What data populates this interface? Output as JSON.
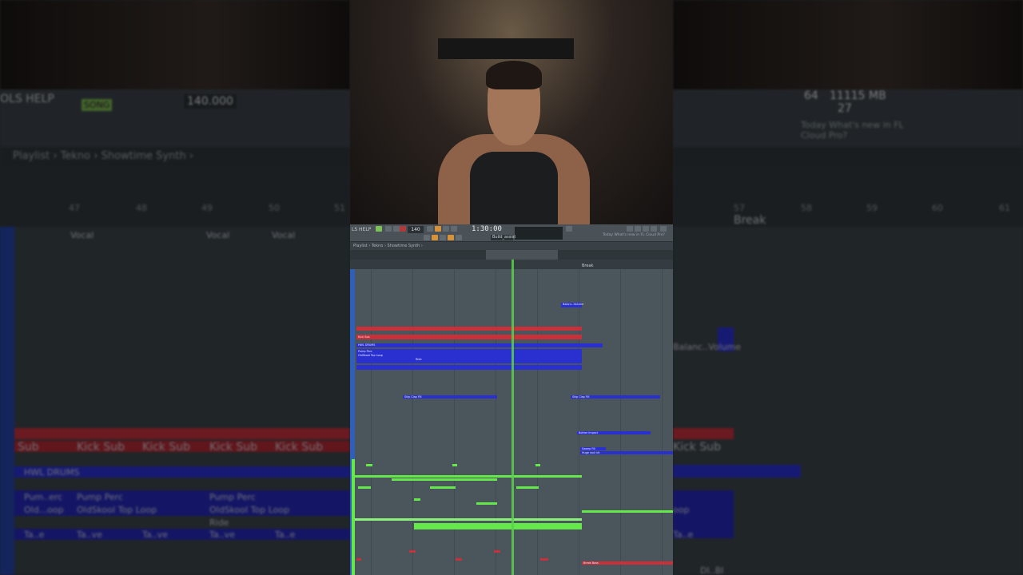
{
  "left_panel": {
    "menu": "OLS HELP",
    "song_label": "SONG",
    "tempo": "140.000",
    "breadcrumb": "Playlist › Tekno › Showtime Synth ›",
    "vocal_labels": [
      "Vocal",
      "Vocal",
      "Vocal",
      "Vocal"
    ],
    "kick_labels": [
      "Sub",
      "Kick Sub",
      "Kick Sub",
      "Kick Sub",
      "Kick Sub",
      "Kick Sub"
    ],
    "drums_label": "HWL DRUMS",
    "perc_labels": [
      "Pum..erc",
      "Pump Perc",
      "Pump Perc"
    ],
    "loop_labels": [
      "Old...oop",
      "OldSkool Top Loop",
      "OldSkool Top Loop"
    ],
    "ride_label": "Ride",
    "tave_labels": [
      "Ta..e",
      "Ta..ve",
      "Ta..ve",
      "Ta..ve",
      "Ta..e",
      "Ta..ve",
      "Ta..ve",
      "Ta..ve",
      "Ta..ve",
      "Ta..e"
    ],
    "ruler_labels": [
      "47",
      "48",
      "49",
      "50",
      "51"
    ]
  },
  "right_panel": {
    "cpu": "64",
    "memory": "11115 MB",
    "voices": "27",
    "news": "Today  What's new in FL Cloud Pro?",
    "ruler_labels": [
      "57",
      "58",
      "59",
      "60",
      "61"
    ],
    "break_label": "Break",
    "volume_label": "Balanc..Volume",
    "kick_label": "Kick Sub",
    "right_misc": [
      "oop",
      "Ta..e",
      "DI..BI"
    ]
  },
  "fl": {
    "menu": "LS HELP",
    "tempo": "140",
    "time": "1:30:00",
    "pattern": "Build_assist",
    "news": "Today  What's new in FL Cloud Pro?",
    "breadcrumb": "Playlist › Tekno › Showtime Synth ›",
    "break_label": "Break",
    "clip_labels": {
      "drums": "HWL DRUMS",
      "balance": "Balanc..Volume",
      "skip_clap_1": "Skip Clap Fill",
      "skip_clap_2": "Skip Clap Fill",
      "bother_impact": "Bother Impact",
      "sweep_fill": "Sweep Fill",
      "huge_rock": "Huge rock kit",
      "break_bass": "Break Bass",
      "pump_perc": "Pump Perc",
      "top_loop": "OldSkool Top Loop",
      "ride": "Ride",
      "kick_sub": "Kick Sub"
    }
  },
  "colors": {
    "clip_blue": "#2a2fd0",
    "clip_red": "#c8303a",
    "clip_green": "#64e84a",
    "playhead": "#58d24a",
    "track_bg": "#4a555c"
  }
}
